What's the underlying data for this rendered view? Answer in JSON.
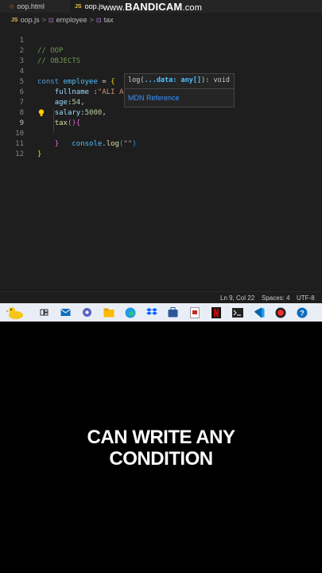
{
  "tabs": [
    {
      "label": "oop.html"
    },
    {
      "label": "oop.js",
      "badge": "JS"
    }
  ],
  "watermark": {
    "www": "www.",
    "brand": "BANDICAM",
    "tld": ".com"
  },
  "breadcrumb": {
    "badge": "JS",
    "file": "oop.js",
    "sep1": ">",
    "sym1_icon": "⊡",
    "object": "employee",
    "sep2": ">",
    "sym2_icon": "⊡",
    "method": "tax"
  },
  "code": {
    "lines": [
      "1",
      "2",
      "3",
      "4",
      "5",
      "6",
      "7",
      "8",
      "9",
      "10",
      "11",
      "12"
    ],
    "comment1": "// OOP",
    "comment2": "// OBJECTS",
    "const_kw": "const",
    "obj_name": "employee",
    "assign": " = ",
    "open_brace": "{",
    "fullname_key": "fullname",
    "fullname_sep": " :",
    "fullname_val": "\"ALI AHEMD\",",
    "age_key": "age",
    "age_sep": ":",
    "age_val": "54",
    "comma1": ",",
    "salary_key": "salary",
    "salary_sep": ":",
    "salary_val": "5000",
    "comma2": ",",
    "tax_fn": "tax",
    "tax_parens": "()",
    "tax_brace": "{",
    "console_obj": "console",
    "dot": ".",
    "log_fn": "log",
    "log_paren_open": "(",
    "log_str": "\"\"",
    "log_paren_close": ")",
    "inner_close": "}",
    "outer_close": "}"
  },
  "hint": {
    "sig_pre": "log(",
    "sig_param": "...data: any[]",
    "sig_post": "): void",
    "link": "MDN Reference"
  },
  "status": {
    "position": "Ln 9, Col 22",
    "spaces": "Spaces: 4",
    "encoding": "UTF-8"
  },
  "taskbar": {
    "icons": [
      "duck-icon",
      "task-view-icon",
      "mail-icon",
      "settings-icon",
      "file-explorer-icon",
      "edge-icon",
      "dropbox-icon",
      "store-icon",
      "app-icon",
      "netflix-icon",
      "terminal-icon",
      "vscode-icon",
      "record-icon",
      "help-icon"
    ]
  },
  "caption": {
    "line1": "CAN WRITE ANY",
    "line2": "CONDITION"
  },
  "colors": {
    "editor_bg": "#1e1e1e",
    "comment": "#6a9955",
    "keyword": "#569cd6",
    "string": "#ce9178",
    "caption": "#ffffff"
  }
}
